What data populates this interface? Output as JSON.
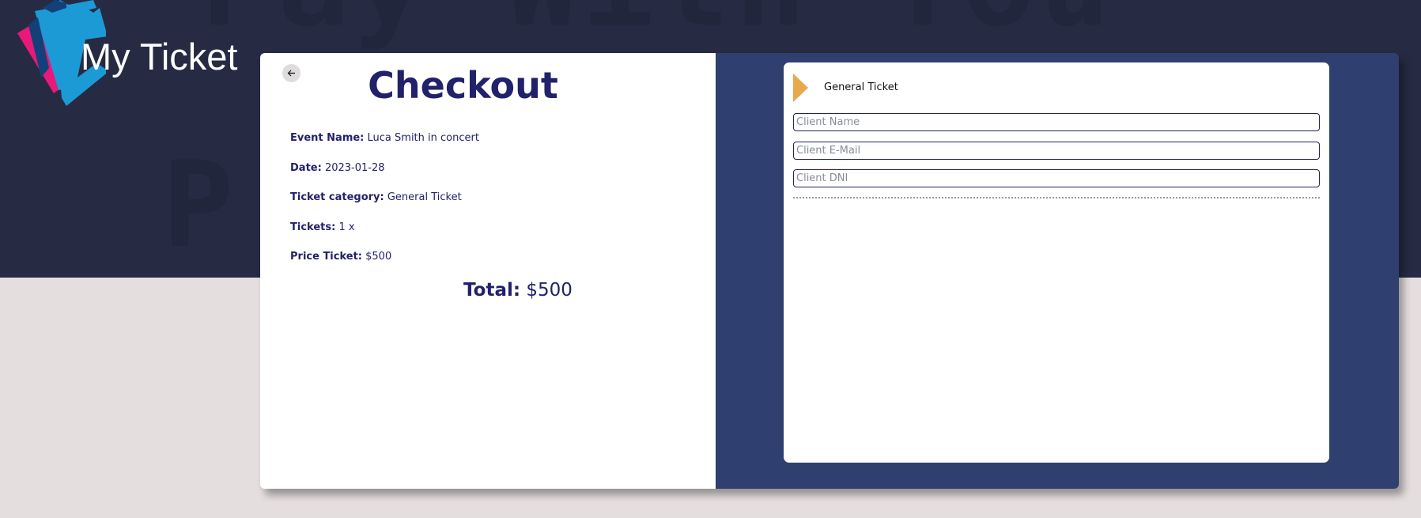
{
  "brand": {
    "name": "My Ticket",
    "colors": {
      "pink": "#e8197a",
      "blue": "#1c9ad6",
      "navy": "#14407a"
    }
  },
  "hero": {
    "watermark_line1": "Pay With You",
    "watermark_line2": "P",
    "background": "#262b43"
  },
  "checkout": {
    "back_icon": "arrow-left-icon",
    "title": "Checkout",
    "details": [
      {
        "label": "Event Name:",
        "value": "Luca Smith in concert"
      },
      {
        "label": "Date:",
        "value": "2023-01-28"
      },
      {
        "label": "Ticket category:",
        "value": "General Ticket"
      },
      {
        "label": "Tickets:",
        "value": "1 x"
      },
      {
        "label": "Price Ticket:",
        "value": "$500"
      }
    ],
    "total_label": "Total:",
    "total_value": "$500"
  },
  "form": {
    "ticket_icon": "triangle-right-icon",
    "ticket_label": "General Ticket",
    "accent": "#e8a94c",
    "fields": [
      {
        "placeholder": "Client Name"
      },
      {
        "placeholder": "Client E-Mail"
      },
      {
        "placeholder": "Client DNI"
      }
    ]
  }
}
